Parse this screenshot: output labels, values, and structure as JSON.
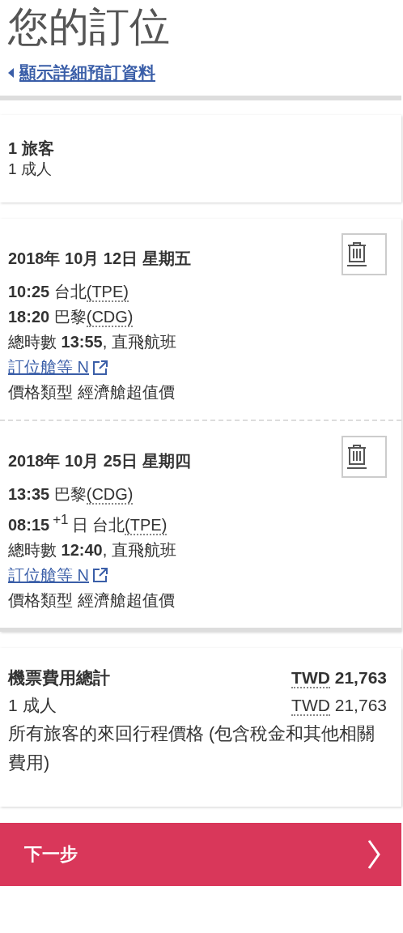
{
  "title": "您的訂位",
  "details_link": "顯示詳細預訂資料",
  "travelers": {
    "heading": "1 旅客",
    "breakdown": "1 成人"
  },
  "flights": [
    {
      "date": "2018年 10月 12日 星期五",
      "departure": {
        "time": "10:25",
        "place": "台北",
        "code": "(TPE)"
      },
      "arrival": {
        "time": "18:20",
        "place": "巴黎",
        "code": "(CDG)"
      },
      "duration": "總時數 **13:55**, 直飛航班",
      "fare_class_link": "訂位艙等 N",
      "fare_type": "價格類型 經濟艙超值價"
    },
    {
      "date": "2018年 10月 25日 星期四",
      "departure": {
        "time": "13:35",
        "place": "巴黎",
        "code": "(CDG)"
      },
      "arrival": {
        "time": "08:15",
        "day_offset": "+1",
        "day_unit": "日",
        "place": "台北",
        "code": "(TPE)"
      },
      "duration": "總時數 **12:40**, 直飛航班",
      "fare_class_link": "訂位艙等 N",
      "fare_type": "價格類型 經濟艙超值價"
    }
  ],
  "total": {
    "label": "機票費用總計",
    "currency": "TWD",
    "amount": "21,763",
    "rows": [
      {
        "label": "1 成人",
        "currency": "TWD",
        "amount": "21,763"
      }
    ],
    "note": "所有旅客的來回行程價格 (包含稅金和其他相關費用)"
  },
  "next_button": "下一步"
}
